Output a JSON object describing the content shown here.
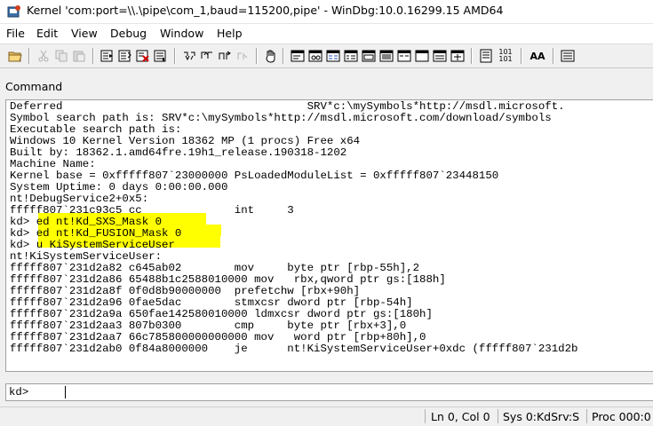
{
  "window": {
    "title": "Kernel 'com:port=\\\\.\\pipe\\com_1,baud=115200,pipe' - WinDbg:10.0.16299.15 AMD64",
    "icon": "windbg-app-icon"
  },
  "menu": {
    "items": [
      "File",
      "Edit",
      "View",
      "Debug",
      "Window",
      "Help"
    ]
  },
  "toolbar": {
    "source_mode_label": "101\n101",
    "font_label": "AA",
    "icons": [
      "open-icon",
      "cut-icon",
      "copy-icon",
      "paste-icon",
      "go-icon",
      "restart-icon",
      "stop-debugging-icon",
      "break-icon",
      "step-into-icon",
      "step-over-icon",
      "step-out-icon",
      "run-to-cursor-icon",
      "hand-icon",
      "command-window-icon",
      "watch-window-icon",
      "locals-window-icon",
      "registers-window-icon",
      "memory-window-icon",
      "call-stack-window-icon",
      "disassembly-window-icon",
      "scratch-pad-icon",
      "processes-threads-icon",
      "source-mode-icon",
      "font-icon",
      "options-icon"
    ]
  },
  "command_window": {
    "title": "Command",
    "highlight_color": "#ffff00",
    "lines": [
      "Deferred                                     SRV*c:\\mySymbols*http://msdl.microsoft.",
      "Symbol search path is: SRV*c:\\mySymbols*http://msdl.microsoft.com/download/symbols",
      "Executable search path is:",
      "Windows 10 Kernel Version 18362 MP (1 procs) Free x64",
      "Built by: 18362.1.amd64fre.19h1_release.190318-1202",
      "Machine Name:",
      "Kernel base = 0xfffff807`23000000 PsLoadedModuleList = 0xfffff807`23448150",
      "System Uptime: 0 days 0:00:00.000",
      "nt!DebugService2+0x5:",
      "fffff807`231c93c5 cc              int     3",
      "kd> ed nt!Kd_SXS_Mask 0",
      "kd> ed nt!Kd_FUSION_Mask 0",
      "kd> u KiSystemServiceUser",
      "nt!KiSystemServiceUser:",
      "fffff807`231d2a82 c645ab02        mov     byte ptr [rbp-55h],2",
      "fffff807`231d2a86 65488b1c2588010000 mov   rbx,qword ptr gs:[188h]",
      "fffff807`231d2a8f 0f0d8b90000000  prefetchw [rbx+90h]",
      "fffff807`231d2a96 0fae5dac        stmxcsr dword ptr [rbp-54h]",
      "fffff807`231d2a9a 650fae142580010000 ldmxcsr dword ptr gs:[180h]",
      "fffff807`231d2aa3 807b0300        cmp     byte ptr [rbx+3],0",
      "fffff807`231d2aa7 66c785800000000000 mov   word ptr [rbp+80h],0",
      "fffff807`231d2ab0 0f84a8000000    je      nt!KiSystemServiceUser+0xdc (fffff807`231d2b"
    ],
    "prompt": "kd>",
    "input_value": ""
  },
  "statusbar": {
    "position": "Ln 0, Col 0",
    "sys": "Sys 0:KdSrv:S",
    "proc": "Proc 000:0"
  }
}
